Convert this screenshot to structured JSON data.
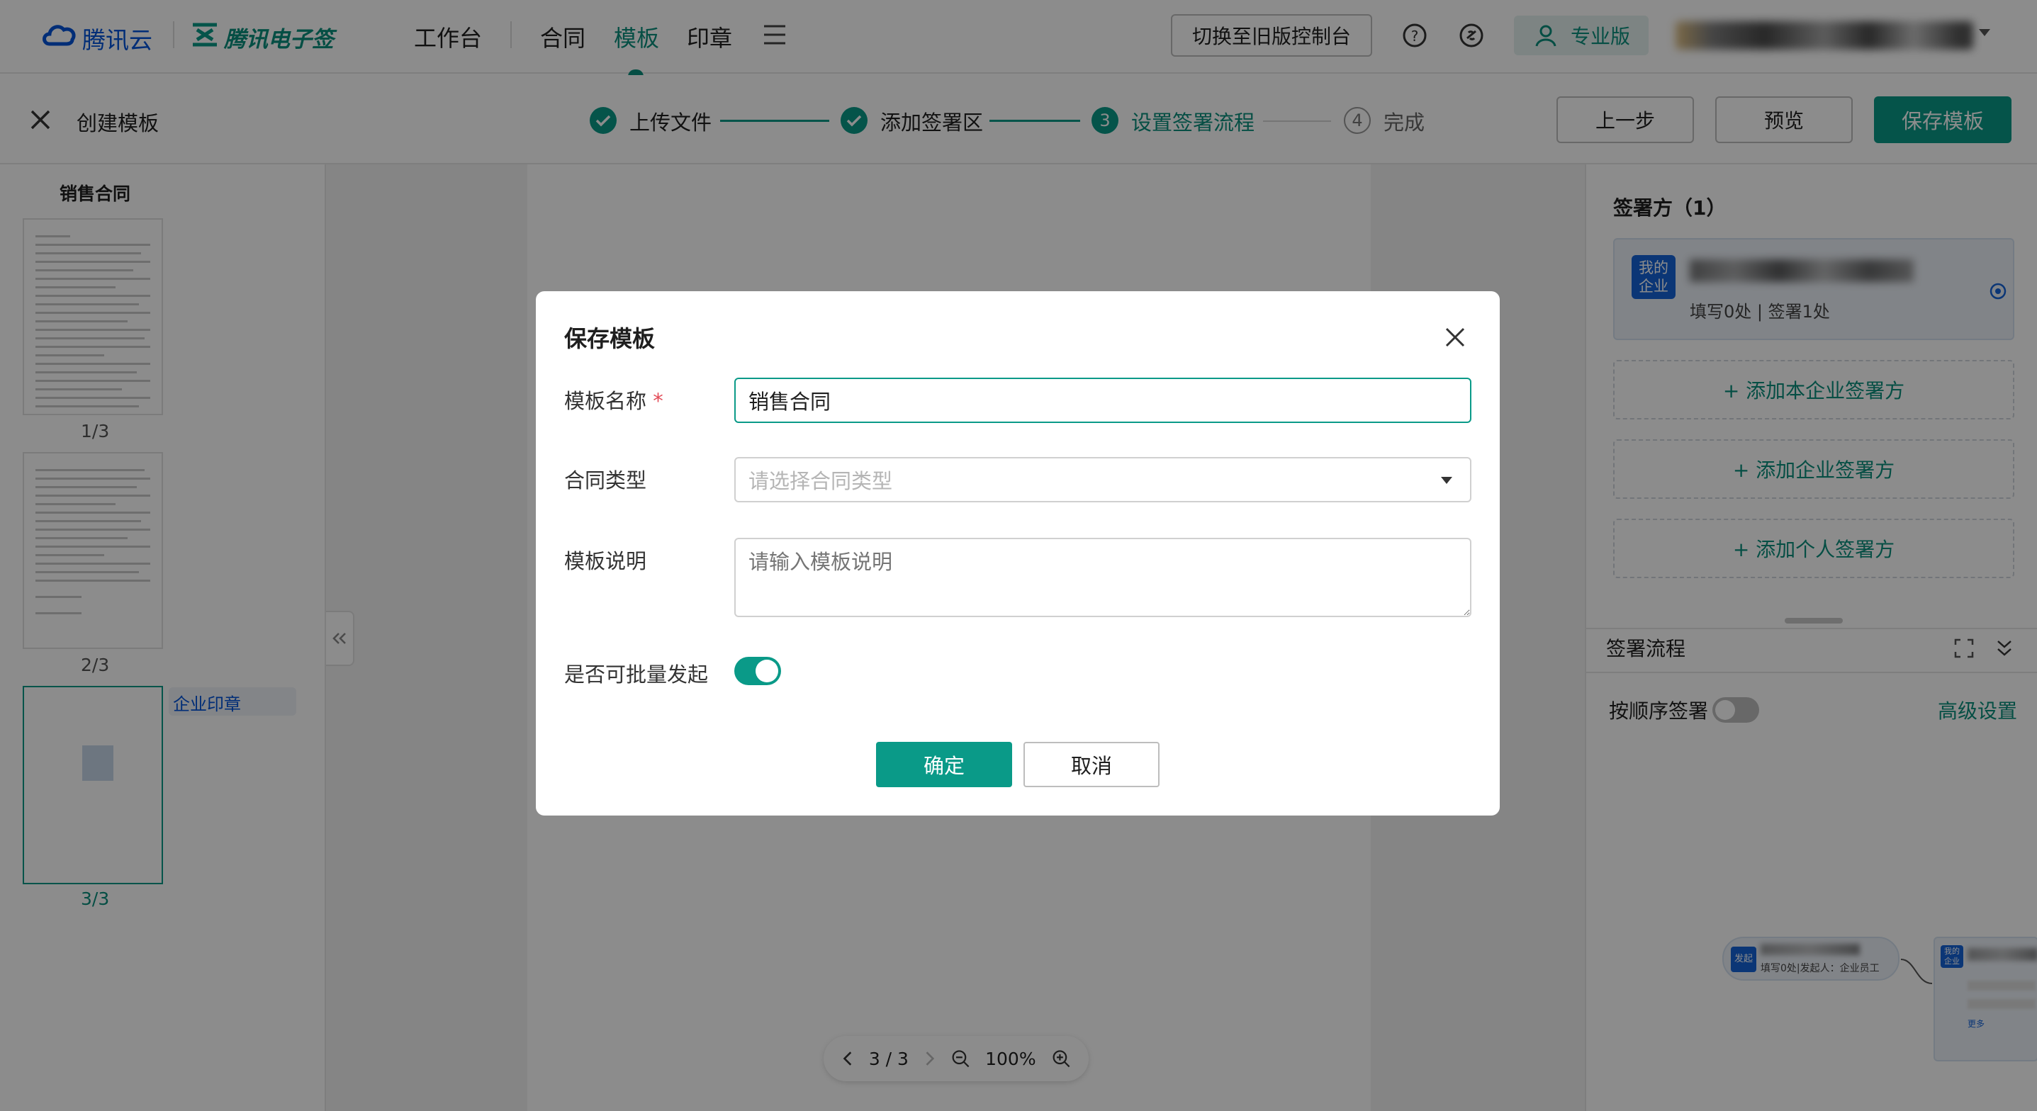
{
  "topnav": {
    "brand_tencent_cloud": "腾讯云",
    "brand_esign": "腾讯电子签",
    "workbench": "工作台",
    "contract": "合同",
    "template": "模板",
    "seal": "印章",
    "switch_console_label": "切换至旧版控制台",
    "edition_label": "专业版",
    "accent_color": "#0a8f7c"
  },
  "steps": {
    "close_label": "创建模板",
    "items": [
      {
        "label": "上传文件",
        "status": "done"
      },
      {
        "label": "添加签署区",
        "status": "done"
      },
      {
        "num": "3",
        "label": "设置签署流程",
        "status": "active"
      },
      {
        "num": "4",
        "label": "完成",
        "status": "pending"
      }
    ],
    "prev_label": "上一步",
    "preview_label": "预览",
    "save_label": "保存模板"
  },
  "leftpanel": {
    "doc_title": "销售合同",
    "pages": [
      "1/3",
      "2/3",
      "3/3"
    ],
    "seal_tag": "企业印章"
  },
  "toolbar": {
    "page_indicator": "3 / 3",
    "zoom": "100%"
  },
  "rightpanel": {
    "signers_title": "签署方（1）",
    "my_company_badge_line1": "我的",
    "my_company_badge_line2": "企业",
    "signer_stats": "填写0处 | 签署1处",
    "add_own_company": "+ 添加本企业签署方",
    "add_company": "+ 添加企业签署方",
    "add_person": "+ 添加个人签署方",
    "flow_title": "签署流程",
    "sequential_label": "按顺序签署",
    "advanced_label": "高级设置",
    "flow_node_badge": "发起",
    "flow_node_text": "填写0处|发起人：企业员工",
    "flow_node2_badge_line1": "我的",
    "flow_node2_badge_line2": "企业",
    "flow_node2_more": "更多"
  },
  "dialog": {
    "title": "保存模板",
    "name_label": "模板名称",
    "required_mark": "*",
    "name_value": "销售合同",
    "type_label": "合同类型",
    "type_placeholder": "请选择合同类型",
    "desc_label": "模板说明",
    "desc_placeholder": "请输入模板说明",
    "batch_label": "是否可批量发起",
    "batch_enabled": true,
    "confirm_label": "确定",
    "cancel_label": "取消"
  }
}
